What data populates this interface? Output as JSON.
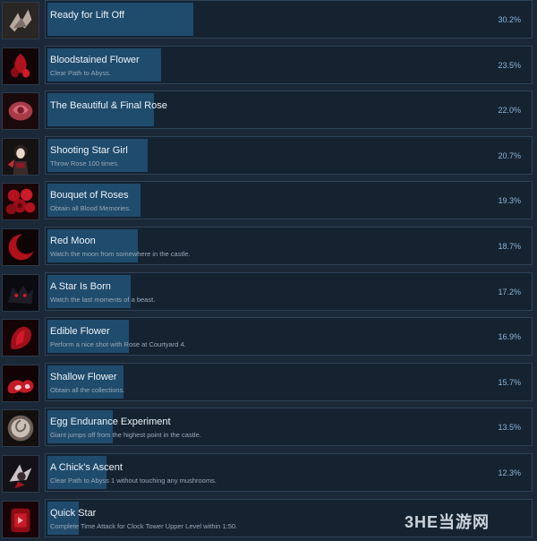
{
  "achievements": [
    {
      "title": "Ready for Lift Off",
      "description": "",
      "percent": "30.2%",
      "fill": 30.2,
      "icon": "wings-icon"
    },
    {
      "title": "Bloodstained Flower",
      "description": "Clear Path to Abyss.",
      "percent": "23.5%",
      "fill": 23.5,
      "icon": "bloodstained-flower-icon"
    },
    {
      "title": "The Beautiful & Final Rose",
      "description": "",
      "percent": "22.0%",
      "fill": 22.0,
      "icon": "rose-icon"
    },
    {
      "title": "Shooting Star Girl",
      "description": "Throw Rose 100 times.",
      "percent": "20.7%",
      "fill": 20.7,
      "icon": "girl-icon"
    },
    {
      "title": "Bouquet of Roses",
      "description": "Obtain all Blood Memories.",
      "percent": "19.3%",
      "fill": 19.3,
      "icon": "bouquet-icon"
    },
    {
      "title": "Red Moon",
      "description": "Watch the moon from somewhere in the castle.",
      "percent": "18.7%",
      "fill": 18.7,
      "icon": "red-moon-icon"
    },
    {
      "title": "A Star Is Born",
      "description": "Watch the last moments of a beast.",
      "percent": "17.2%",
      "fill": 17.2,
      "icon": "beast-icon"
    },
    {
      "title": "Edible Flower",
      "description": "Perform a nice shot with Rose at Courtyard 4.",
      "percent": "16.9%",
      "fill": 16.9,
      "icon": "edible-flower-icon"
    },
    {
      "title": "Shallow Flower",
      "description": "Obtain all the collections.",
      "percent": "15.7%",
      "fill": 15.7,
      "icon": "shallow-flower-icon"
    },
    {
      "title": "Egg Endurance Experiment",
      "description": "Giant jumps off from the highest point in the castle.",
      "percent": "13.5%",
      "fill": 13.5,
      "icon": "egg-icon"
    },
    {
      "title": "A Chick's Ascent",
      "description": "Clear Path to Abyss 1 without touching any mushrooms.",
      "percent": "12.3%",
      "fill": 12.3,
      "icon": "chick-icon"
    },
    {
      "title": "Quick Star",
      "description": "Complete Time Attack for Clock Tower Upper Level within 1:50.",
      "percent": "",
      "fill": 6.5,
      "icon": "quick-star-icon"
    }
  ],
  "watermark": "3HE当游网",
  "colors": {
    "background": "#1b2838",
    "panel": "#152331",
    "bar": "#1f4b6d",
    "percent": "#8cb5d9"
  }
}
